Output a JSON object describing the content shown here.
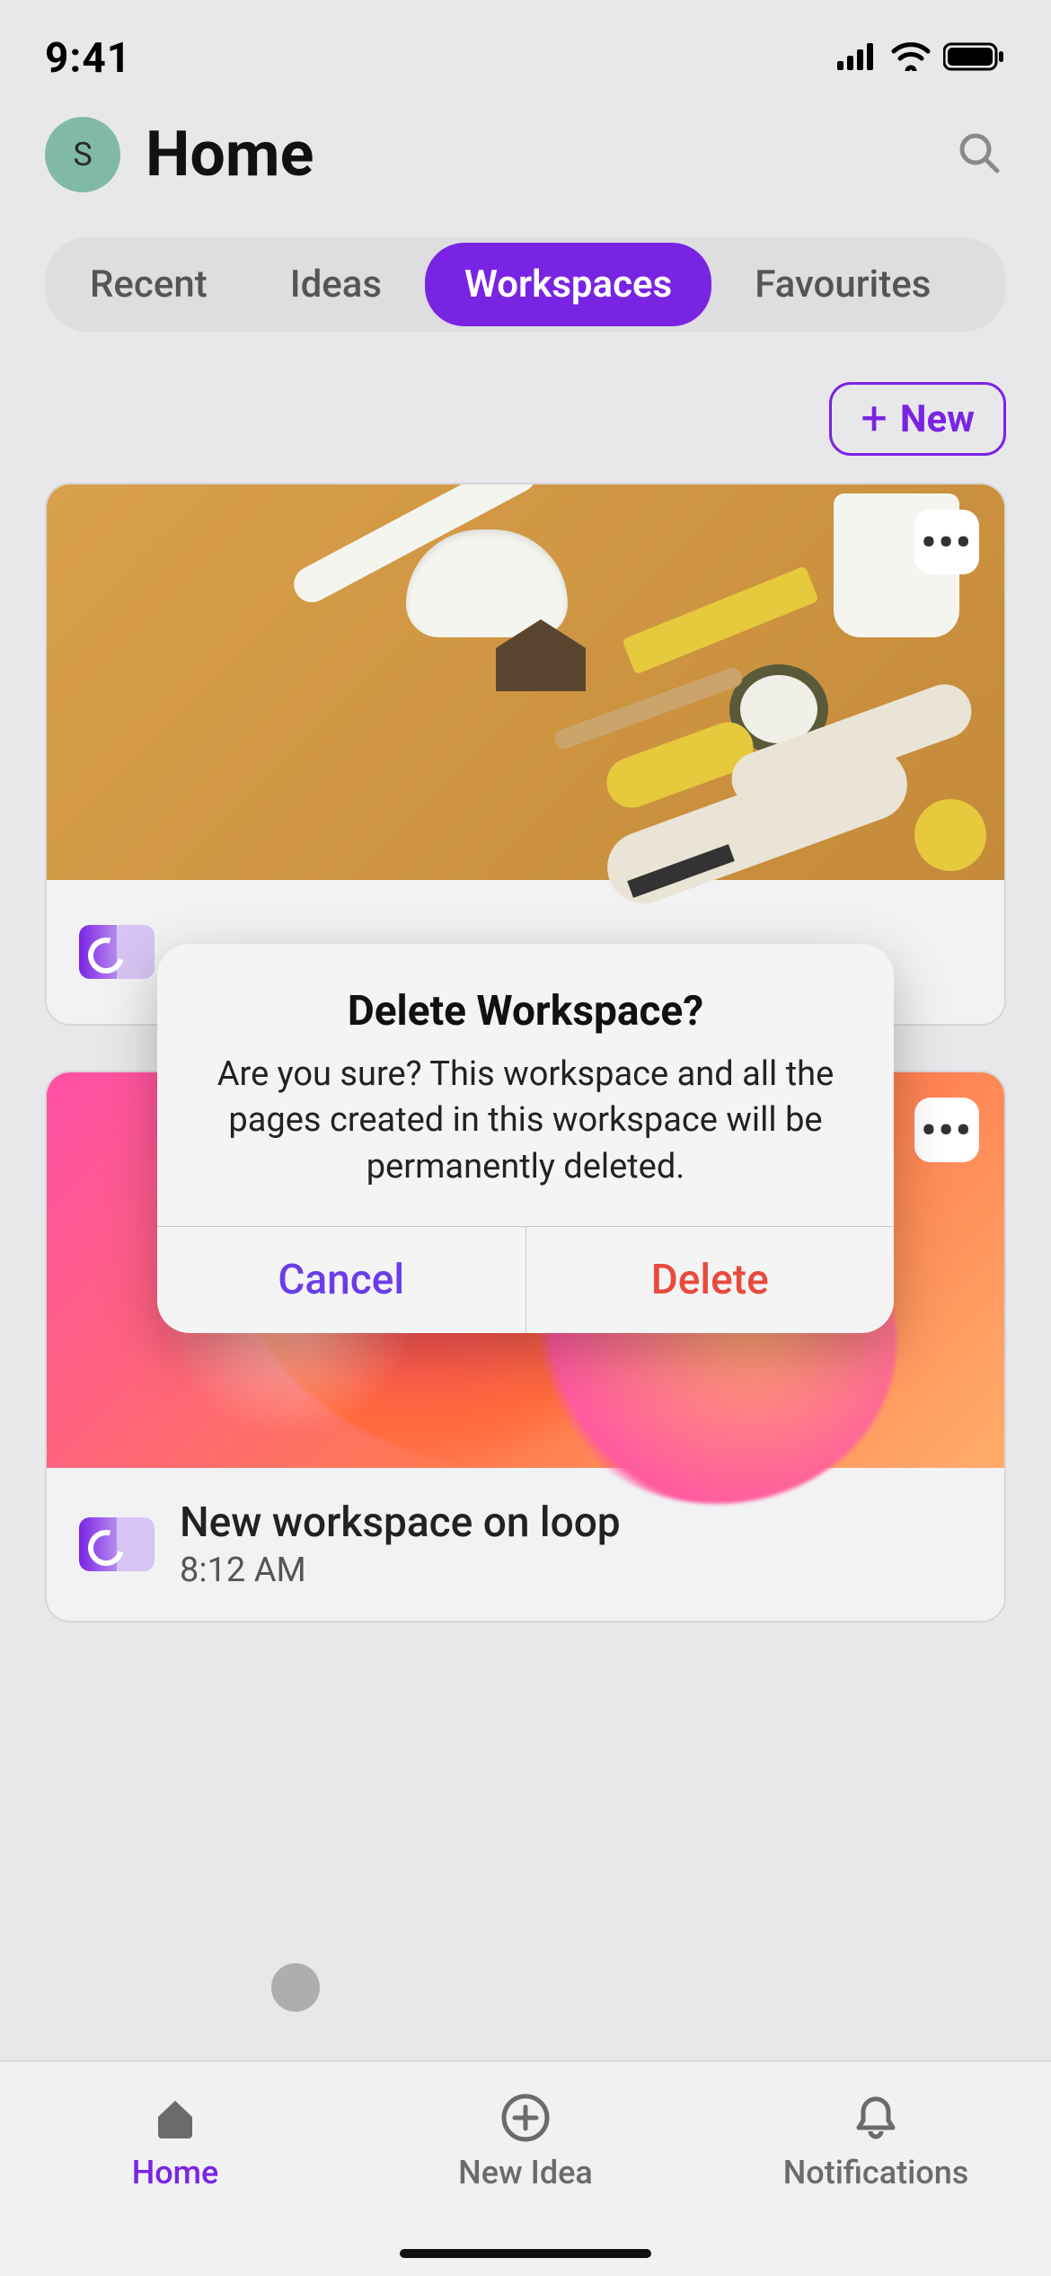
{
  "status_bar": {
    "time": "9:41"
  },
  "header": {
    "avatar_initial": "S",
    "title": "Home"
  },
  "tabs": [
    {
      "label": "Recent",
      "active": false
    },
    {
      "label": "Ideas",
      "active": false
    },
    {
      "label": "Workspaces",
      "active": true
    },
    {
      "label": "Favourites",
      "active": false
    }
  ],
  "new_button": {
    "label": "New"
  },
  "cards": [
    {
      "title": "",
      "time": ""
    },
    {
      "title": "New workspace on loop",
      "time": "8:12 AM"
    }
  ],
  "modal": {
    "title": "Delete Workspace?",
    "message": "Are you sure? This workspace and all the pages created in this workspace will be permanently deleted.",
    "cancel_label": "Cancel",
    "delete_label": "Delete"
  },
  "bottom_nav": {
    "home": "Home",
    "new_idea": "New Idea",
    "notifications": "Notifications"
  }
}
